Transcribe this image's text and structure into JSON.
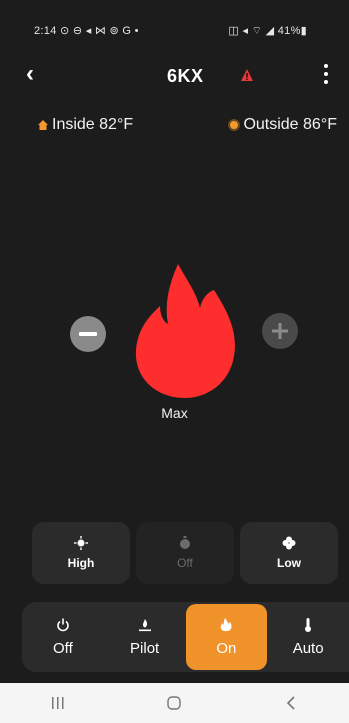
{
  "status": {
    "left": "2:14 ⊙ ⊖ ◂ ⋈ ⊚ G •",
    "right": "◫ ◂ ⌔ ◢ 41%▮"
  },
  "header": {
    "title": "6KX"
  },
  "temps": {
    "inside_label": "Inside 82°F",
    "outside_label": "Outside 86°F"
  },
  "flame": {
    "level_label": "Max"
  },
  "fan_buttons": [
    {
      "label": "High"
    },
    {
      "label": "Off"
    },
    {
      "label": "Low"
    }
  ],
  "modes": [
    {
      "label": "Off"
    },
    {
      "label": "Pilot"
    },
    {
      "label": "On"
    },
    {
      "label": "Auto"
    }
  ],
  "colors": {
    "accent": "#f0932b",
    "flame": "#ff2e2e",
    "background": "#1c1c1c"
  }
}
